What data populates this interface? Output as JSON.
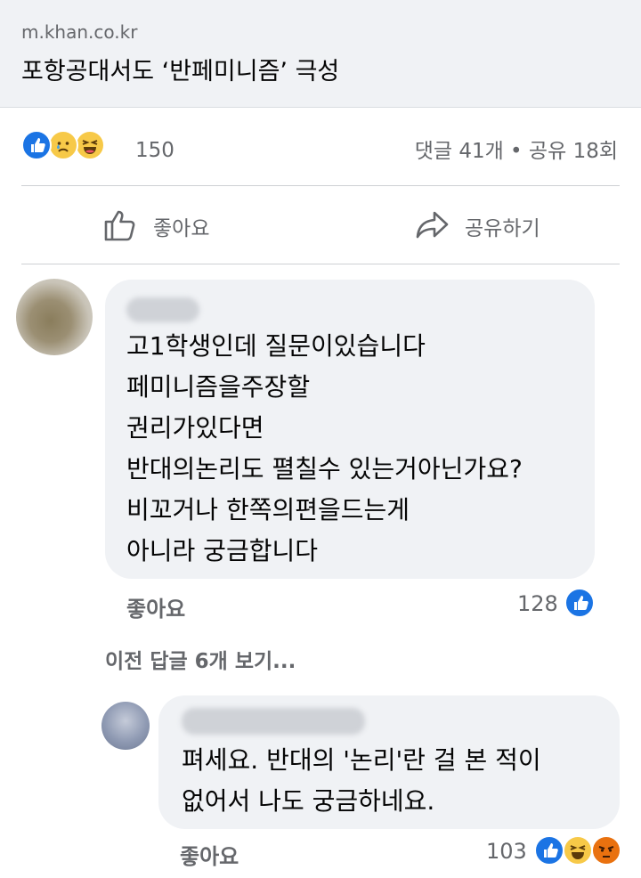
{
  "link": {
    "domain": "m.khan.co.kr",
    "headline": "포항공대서도 ‘반페미니즘’ 극성"
  },
  "stats": {
    "reaction_icons": [
      "like-icon",
      "sad-icon",
      "haha-icon"
    ],
    "reaction_count": "150",
    "comments_shares": "댓글 41개 • 공유 18회"
  },
  "actions": {
    "like_label": "좋아요",
    "share_label": "공유하기"
  },
  "comments": [
    {
      "lines": [
        "고1학생인데 질문이있습니다",
        "페미니즘을주장할",
        "권리가있다면",
        "반대의논리도 펼칠수 있는거아닌가요?",
        "비꼬거나 한쪽의편을드는게",
        "아니라 궁금합니다"
      ],
      "like_label": "좋아요",
      "reaction_count": "128",
      "reaction_icons": [
        "like-icon"
      ]
    }
  ],
  "view_previous": "이전 답글 6개 보기...",
  "reply": {
    "lines": [
      "펴세요. 반대의 '논리'란 걸 본 적이",
      "없어서 나도 궁금하네요."
    ],
    "like_label": "좋아요",
    "reaction_count": "103",
    "reaction_icons": [
      "like-icon",
      "haha-icon",
      "angry-icon"
    ]
  },
  "colors": {
    "like_blue": "#1b74e4",
    "emoji_yellow": "#f7c948",
    "angry_orange": "#e9710f",
    "secondary_text": "#65676b",
    "bubble_bg": "#f0f2f5"
  }
}
